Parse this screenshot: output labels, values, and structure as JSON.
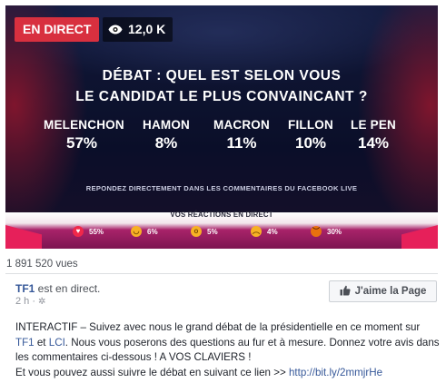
{
  "video": {
    "live_label": "EN DIRECT",
    "views": "12,0 K",
    "question_line1": "DÉBAT : QUEL EST SELON VOUS",
    "question_line2": "LE CANDIDAT LE PLUS CONVAINCANT ?",
    "candidates": [
      {
        "name": "MELENCHON",
        "percent": "57%"
      },
      {
        "name": "HAMON",
        "percent": "8%"
      },
      {
        "name": "MACRON",
        "percent": "11%"
      },
      {
        "name": "FILLON",
        "percent": "10%"
      },
      {
        "name": "LE PEN",
        "percent": "14%"
      }
    ],
    "cta": "REPONDEZ DIRECTEMENT DANS LES COMMENTAIRES DU FACEBOOK LIVE",
    "reactions_title": "VOS RÉACTIONS EN DIRECT",
    "reactions": [
      {
        "icon": "heart-icon",
        "value": "55%",
        "color": "#f0284a"
      },
      {
        "icon": "haha-icon",
        "value": "6%",
        "color": "#f7b125"
      },
      {
        "icon": "wow-icon",
        "value": "5%",
        "color": "#f7b125"
      },
      {
        "icon": "sad-icon",
        "value": "4%",
        "color": "#f7b125"
      },
      {
        "icon": "angry-icon",
        "value": "30%",
        "color": "#e9710f"
      }
    ]
  },
  "post": {
    "view_count": "1 891 520 vues",
    "page_name": "TF1",
    "status": " est en direct.",
    "time": "2 h ·",
    "like_page_label": "J'aime la Page",
    "text_part1": "INTERACTIF – Suivez avec nous le grand débat de la présidentielle en ce moment sur ",
    "link_tf1": "TF1",
    "text_part2": " et ",
    "link_lci": "LCI",
    "text_part3": ". Nous vous poserons des questions au fur et à mesure. Donnez votre avis dans les commentaires ci-dessous ! A VOS CLAVIERS !",
    "text_part4": "Et vous pouvez aussi suivre le débat en suivant ce lien >> ",
    "link_url": "http://bit.ly/2mmjrHe"
  },
  "colors": {
    "live_red": "#d8303f",
    "link_blue": "#365899"
  }
}
